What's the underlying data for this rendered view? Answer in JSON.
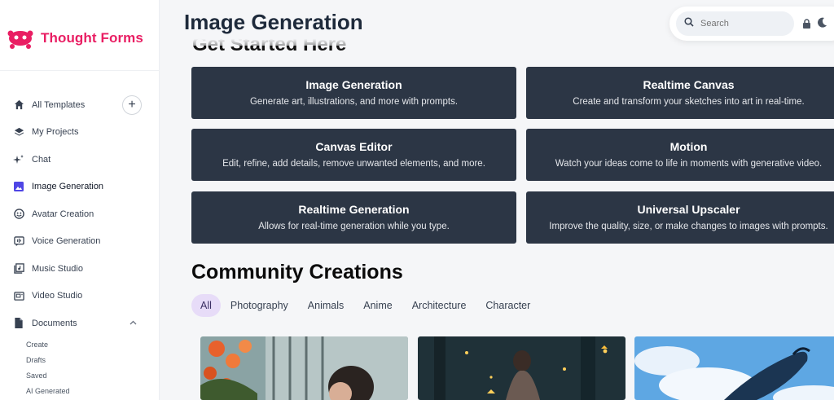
{
  "brand": {
    "name": "Thought Forms"
  },
  "sidebar": {
    "items": [
      {
        "label": "All Templates",
        "icon": "home-icon"
      },
      {
        "label": "My Projects",
        "icon": "layers-icon"
      },
      {
        "label": "Chat",
        "icon": "sparkle-icon"
      },
      {
        "label": "Image Generation",
        "icon": "image-icon"
      },
      {
        "label": "Avatar Creation",
        "icon": "avatar-icon"
      },
      {
        "label": "Voice Generation",
        "icon": "voice-icon"
      },
      {
        "label": "Music Studio",
        "icon": "music-icon"
      },
      {
        "label": "Video Studio",
        "icon": "video-icon"
      },
      {
        "label": "Documents",
        "icon": "document-icon"
      }
    ],
    "documents_sub": [
      "Create",
      "Drafts",
      "Saved",
      "AI Generated"
    ],
    "add_label": "+"
  },
  "header": {
    "title": "Image Generation",
    "subtitle_partial": "Get Started Here",
    "search_placeholder": "Search"
  },
  "cards": [
    {
      "title": "Image Generation",
      "desc": "Generate art, illustrations, and more with prompts."
    },
    {
      "title": "Realtime Canvas",
      "desc": "Create and transform your sketches into art in real-time."
    },
    {
      "title": "Canvas Editor",
      "desc": "Edit, refine, add details, remove unwanted elements, and more."
    },
    {
      "title": "Motion",
      "desc": "Watch your ideas come to life in moments with generative video."
    },
    {
      "title": "Realtime Generation",
      "desc": "Allows for real-time generation while you type."
    },
    {
      "title": "Universal Upscaler",
      "desc": "Improve the quality, size, or make changes to images with prompts."
    }
  ],
  "community": {
    "title": "Community Creations",
    "tabs": [
      "All",
      "Photography",
      "Animals",
      "Anime",
      "Architecture",
      "Character"
    ],
    "active_tab": "All"
  },
  "colors": {
    "brand": "#e91e63",
    "card_bg": "#2c3645",
    "active_tab_bg": "#e7dcf8",
    "active_icon": "#4f46e5"
  }
}
